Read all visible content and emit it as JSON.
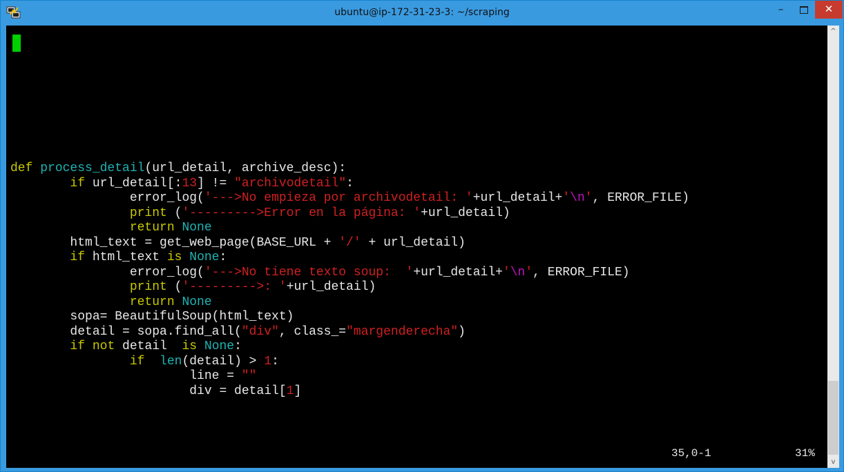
{
  "window": {
    "title": "ubuntu@ip-172-31-23-3: ~/scraping",
    "controls": {
      "minimize": "–",
      "close": "✕"
    }
  },
  "colors": {
    "keyword": "#c9c900",
    "function": "#1fb3b3",
    "string": "#d02020",
    "escape": "#c010c0",
    "cursor": "#00d000",
    "text": "#e8e8e8",
    "background": "#000000"
  },
  "editor": {
    "lines": [
      [
        {
          "t": "def",
          "c": "kw"
        },
        {
          "t": " "
        },
        {
          "t": "process_detail",
          "c": "fn"
        },
        {
          "t": "(url_detail, archive_desc):"
        }
      ],
      [
        {
          "t": "        "
        },
        {
          "t": "if",
          "c": "kw"
        },
        {
          "t": " url_detail[:"
        },
        {
          "t": "13",
          "c": "str"
        },
        {
          "t": "] != "
        },
        {
          "t": "\"archivodetail\"",
          "c": "str"
        },
        {
          "t": ":"
        }
      ],
      [
        {
          "t": "                error_log("
        },
        {
          "t": "'--->No empieza por archivodetail: '",
          "c": "str"
        },
        {
          "t": "+url_detail+"
        },
        {
          "t": "'",
          "c": "str"
        },
        {
          "t": "\\n",
          "c": "esc"
        },
        {
          "t": "'",
          "c": "str"
        },
        {
          "t": ", ERROR_FILE)"
        }
      ],
      [
        {
          "t": "                "
        },
        {
          "t": "print",
          "c": "kw"
        },
        {
          "t": " ("
        },
        {
          "t": "'--------->Error en la página: '",
          "c": "str"
        },
        {
          "t": "+url_detail)"
        }
      ],
      [
        {
          "t": "                "
        },
        {
          "t": "return",
          "c": "kw"
        },
        {
          "t": " "
        },
        {
          "t": "None",
          "c": "fn"
        }
      ],
      [
        {
          "t": "        html_text = get_web_page(BASE_URL + "
        },
        {
          "t": "'/'",
          "c": "str"
        },
        {
          "t": " + url_detail)"
        }
      ],
      [
        {
          "t": "        "
        },
        {
          "t": "if",
          "c": "kw"
        },
        {
          "t": " html_text "
        },
        {
          "t": "is",
          "c": "kw"
        },
        {
          "t": " "
        },
        {
          "t": "None",
          "c": "fn"
        },
        {
          "t": ":"
        }
      ],
      [
        {
          "t": "                error_log("
        },
        {
          "t": "'--->No tiene texto soup:  '",
          "c": "str"
        },
        {
          "t": "+url_detail+"
        },
        {
          "t": "'",
          "c": "str"
        },
        {
          "t": "\\n",
          "c": "esc"
        },
        {
          "t": "'",
          "c": "str"
        },
        {
          "t": ", ERROR_FILE)"
        }
      ],
      [
        {
          "t": "                "
        },
        {
          "t": "print",
          "c": "kw"
        },
        {
          "t": " ("
        },
        {
          "t": "'--------->: '",
          "c": "str"
        },
        {
          "t": "+url_detail)"
        }
      ],
      [
        {
          "t": "                "
        },
        {
          "t": "return",
          "c": "kw"
        },
        {
          "t": " "
        },
        {
          "t": "None",
          "c": "fn"
        }
      ],
      [
        {
          "t": "        sopa= BeautifulSoup(html_text)"
        }
      ],
      [
        {
          "t": "        detail = sopa.find_all("
        },
        {
          "t": "\"div\"",
          "c": "str"
        },
        {
          "t": ", class_="
        },
        {
          "t": "\"margenderecha\"",
          "c": "str"
        },
        {
          "t": ")"
        }
      ],
      [
        {
          "t": "        "
        },
        {
          "t": "if",
          "c": "kw"
        },
        {
          "t": " "
        },
        {
          "t": "not",
          "c": "kw"
        },
        {
          "t": " detail  "
        },
        {
          "t": "is",
          "c": "kw"
        },
        {
          "t": " "
        },
        {
          "t": "None",
          "c": "fn"
        },
        {
          "t": ":"
        }
      ],
      [
        {
          "t": "                "
        },
        {
          "t": "if",
          "c": "kw"
        },
        {
          "t": "  "
        },
        {
          "t": "len",
          "c": "fn"
        },
        {
          "t": "(detail) > "
        },
        {
          "t": "1",
          "c": "str"
        },
        {
          "t": ":"
        }
      ],
      [
        {
          "t": "                        line = "
        },
        {
          "t": "\"\"",
          "c": "str"
        }
      ],
      [
        {
          "t": "                        div = detail["
        },
        {
          "t": "1",
          "c": "str"
        },
        {
          "t": "]"
        }
      ]
    ]
  },
  "status": {
    "position": "35,0-1",
    "percent": "31%"
  },
  "scrollbar": {
    "up_arrow": "^",
    "down_arrow": "v"
  }
}
